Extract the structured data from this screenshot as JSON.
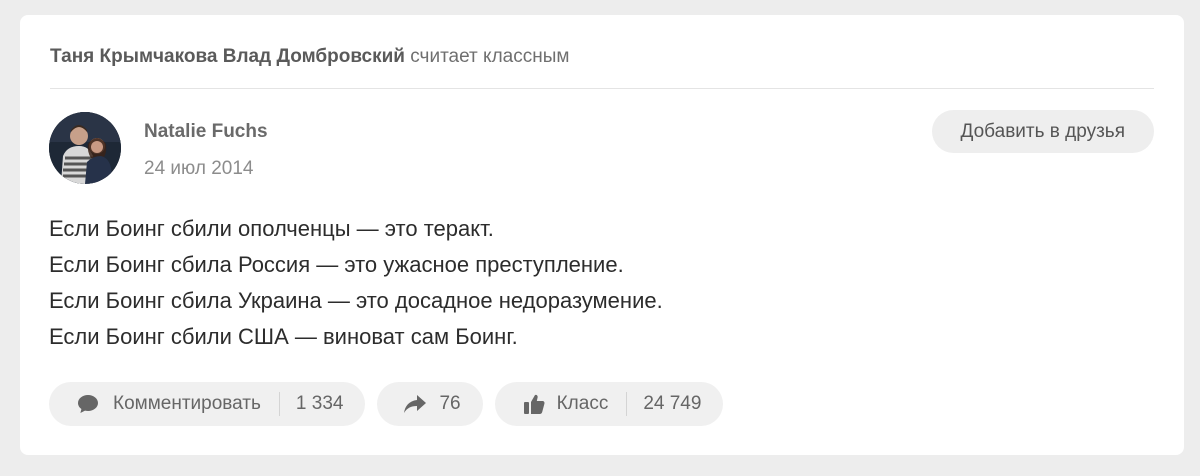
{
  "feed_header": {
    "actor_1": "Таня Крымчакова",
    "actor_2": "Влад Домбровский",
    "action_text": "считает классным"
  },
  "post": {
    "author_name": "Natalie Fuchs",
    "date": "24 июл 2014",
    "add_friend_label": "Добавить в друзья",
    "text_lines": [
      "Если Боинг сбили ополченцы — это теракт.",
      "Если Боинг сбила Россия — это ужасное преступление.",
      "Если Боинг сбила Украина — это досадное недоразумение.",
      "Если Боинг сбили США — виноват сам Боинг."
    ]
  },
  "actions": {
    "comment_label": "Комментировать",
    "comment_count": "1 334",
    "share_count": "76",
    "class_label": "Класс",
    "class_count": "24 749"
  },
  "icons": {
    "comment": "comment-bubble-icon",
    "share": "share-arrow-icon",
    "class": "thumbs-up-icon"
  },
  "colors": {
    "background": "#ededed",
    "card": "#ffffff",
    "pill": "#f0f0f0",
    "text": "#2c2c2c"
  }
}
